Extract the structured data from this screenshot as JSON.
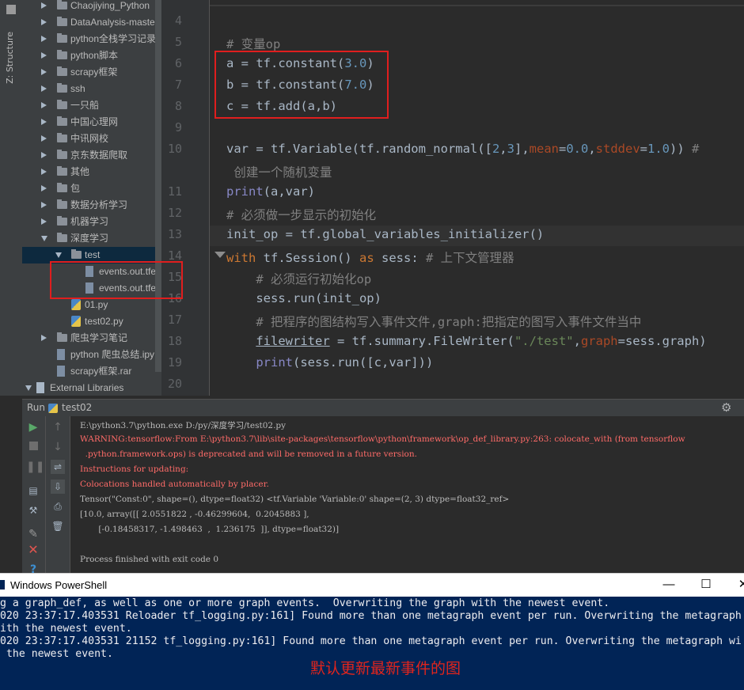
{
  "sidebar_tab": "Z: Structure",
  "tree": [
    {
      "label": "Chaojiying_Python",
      "kind": "folder",
      "indent": 1,
      "expanded": false
    },
    {
      "label": "DataAnalysis-maste",
      "kind": "folder",
      "indent": 1,
      "expanded": false
    },
    {
      "label": "python全栈学习记录",
      "kind": "folder",
      "indent": 1,
      "expanded": false
    },
    {
      "label": "python脚本",
      "kind": "folder",
      "indent": 1,
      "expanded": false
    },
    {
      "label": "scrapy框架",
      "kind": "folder",
      "indent": 1,
      "expanded": false
    },
    {
      "label": "ssh",
      "kind": "folder",
      "indent": 1,
      "expanded": false
    },
    {
      "label": "一只船",
      "kind": "folder",
      "indent": 1,
      "expanded": false
    },
    {
      "label": "中国心理网",
      "kind": "folder",
      "indent": 1,
      "expanded": false
    },
    {
      "label": "中讯网校",
      "kind": "folder",
      "indent": 1,
      "expanded": false
    },
    {
      "label": "京东数据爬取",
      "kind": "folder",
      "indent": 1,
      "expanded": false
    },
    {
      "label": "其他",
      "kind": "folder",
      "indent": 1,
      "expanded": false
    },
    {
      "label": "包",
      "kind": "folder",
      "indent": 1,
      "expanded": false
    },
    {
      "label": "数据分析学习",
      "kind": "folder",
      "indent": 1,
      "expanded": false
    },
    {
      "label": "机器学习",
      "kind": "folder",
      "indent": 1,
      "expanded": false
    },
    {
      "label": "深度学习",
      "kind": "folder",
      "indent": 1,
      "expanded": true
    },
    {
      "label": "test",
      "kind": "folder",
      "indent": 2,
      "expanded": true,
      "selected": true
    },
    {
      "label": "events.out.tfe",
      "kind": "file",
      "indent": 3
    },
    {
      "label": "events.out.tfe",
      "kind": "file",
      "indent": 3
    },
    {
      "label": "01.py",
      "kind": "py",
      "indent": 2
    },
    {
      "label": "test02.py",
      "kind": "py",
      "indent": 2
    },
    {
      "label": "爬虫学习笔记",
      "kind": "folder",
      "indent": 1,
      "expanded": false
    },
    {
      "label": "python 爬虫总结.ipy",
      "kind": "file",
      "indent": 1
    },
    {
      "label": "scrapy框架.rar",
      "kind": "file",
      "indent": 1
    },
    {
      "label": "External Libraries",
      "kind": "lib",
      "indent": 0,
      "expanded": true
    }
  ],
  "line_numbers": [
    "4",
    "5",
    "6",
    "7",
    "8",
    "9",
    "10",
    "",
    "11",
    "12",
    "13",
    "14",
    "15",
    "16",
    "17",
    "18",
    "19",
    "20"
  ],
  "code": {
    "l5": "# 变量op",
    "l6_var": "a",
    "l6_op": " = tf.constant(",
    "l6_num": "3.0",
    "l6_end": ")",
    "l7_var": "b",
    "l7_op": " = tf.constant(",
    "l7_num": "7.0",
    "l7_end": ")",
    "l8": "c = tf.add(a,b)",
    "l10_a": "var = tf.Variable(tf.random_normal([",
    "l10_n1": "2",
    "l10_c": ",",
    "l10_n2": "3",
    "l10_b": "],",
    "l10_p1": "mean",
    "l10_e1": "=",
    "l10_v1": "0.0",
    "l10_c2": ",",
    "l10_p2": "stddev",
    "l10_e2": "=",
    "l10_v2": "1.0",
    "l10_end": ")) ",
    "l10_cm": "#",
    "l10_cm2": " 创建一个随机变量",
    "l11_fn": "print",
    "l11_rest": "(a,var)",
    "l12": "# 必须做一步显示的初始化",
    "l13": "init_op = tf.global_variables_initializer()",
    "l14_kw": "with",
    "l14_mid": " tf.Session() ",
    "l14_kw2": "as",
    "l14_rest": " sess: ",
    "l14_cm": "# 上下文管理器",
    "l15": "    # 必须运行初始化op",
    "l16": "    sess.run(init_op)",
    "l17": "    # 把程序的图结构写入事件文件,graph:把指定的图写入事件文件当中",
    "l18_a": "    ",
    "l18_fw": "filewriter",
    "l18_b": " = tf.summary.FileWriter(",
    "l18_str": "\"./test\"",
    "l18_c": ",",
    "l18_p": "graph",
    "l18_d": "=sess.graph)",
    "l19_fn": "    print",
    "l19_rest": "(sess.run([c,var]))"
  },
  "run": {
    "label": "Run",
    "config": "test02",
    "lines": [
      {
        "text": "E:\\python3.7\\python.exe D:/py/深度学习/test02.py",
        "color": "normal"
      },
      {
        "text": "WARNING:tensorflow:From E:\\python3.7\\lib\\site-packages\\tensorflow\\python\\framework\\op_def_library.py:263: colocate_with (from tensorflow",
        "color": "red"
      },
      {
        "text": "  .python.framework.ops) is deprecated and will be removed in a future version.",
        "color": "red"
      },
      {
        "text": "Instructions for updating:",
        "color": "red"
      },
      {
        "text": "Colocations handled automatically by placer.",
        "color": "red"
      },
      {
        "text": "Tensor(\"Const:0\", shape=(), dtype=float32) <tf.Variable 'Variable:0' shape=(2, 3) dtype=float32_ref>",
        "color": "normal"
      },
      {
        "text": "[10.0, array([[ 2.0551822 , -0.46299604,  0.2045883 ],",
        "color": "normal"
      },
      {
        "text": "       [-0.18458317, -1.498463  ,  1.236175  ]], dtype=float32)]",
        "color": "normal"
      },
      {
        "text": "",
        "color": "normal"
      },
      {
        "text": "Process finished with exit code 0",
        "color": "normal"
      }
    ]
  },
  "powershell": {
    "title": "Windows PowerShell",
    "minimize": "—",
    "maximize": "☐",
    "close": "✕",
    "lines": [
      "g a graph_def, as well as one or more graph events.  Overwriting the graph with the newest event.",
      "020 23:37:17.403531 Reloader tf_logging.py:161] Found more than one metagraph event per run. Overwriting the metagraph",
      "ith the newest event.",
      "020 23:37:17.403531 21152 tf_logging.py:161] Found more than one metagraph event per run. Overwriting the metagraph wi",
      " the newest event."
    ],
    "annotation": "默认更新最新事件的图",
    "annotation_color": "#e0241d"
  },
  "colors": {
    "highlight_box": "#e01e1e",
    "selection": "#0d293e"
  }
}
